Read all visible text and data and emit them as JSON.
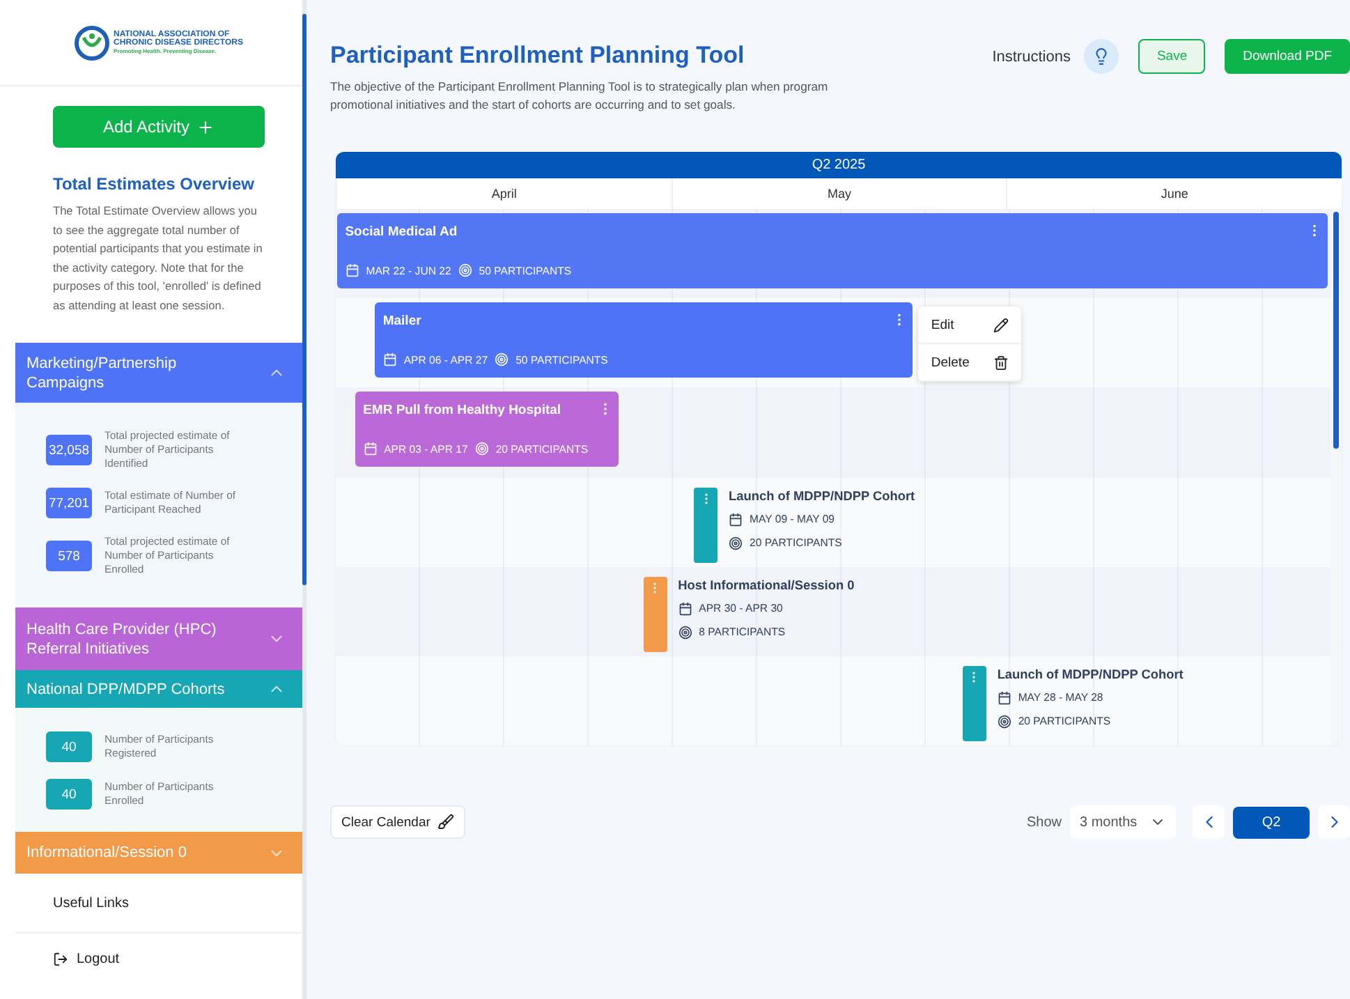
{
  "sidebar": {
    "logo": {
      "lines": [
        "NATIONAL ASSOCIATION OF",
        "CHRONIC DISEASE DIRECTORS",
        "Promoting Health. Preventing Disease."
      ]
    },
    "add_button": "Add Activity",
    "overview": {
      "title": "Total Estimates Overview",
      "text": "The Total Estimate Overview allows you to see the aggregate total number of potential participants that you estimate in the activity category. Note that for the purposes of this tool, 'enrolled' is defined as attending at least one session."
    },
    "categories": [
      {
        "title": "Marketing/Partnership Campaigns",
        "color": "#4f73f5",
        "expanded": true,
        "stats": [
          {
            "value": "32,058",
            "label": "Total projected estimate of Number of Participants Identified"
          },
          {
            "value": "77,201",
            "label": "Total estimate of Number of Participant Reached"
          },
          {
            "value": "578",
            "label": "Total projected estimate of Number of Participants Enrolled"
          }
        ]
      },
      {
        "title": "Health Care Provider (HPC) Referral Initiatives",
        "color": "#b965d8",
        "expanded": false
      },
      {
        "title": "National DPP/MDPP Cohorts",
        "color": "#17a6b4",
        "expanded": true,
        "stats": [
          {
            "value": "40",
            "label": "Number of Participants Registered"
          },
          {
            "value": "40",
            "label": "Number of Participants Enrolled"
          }
        ]
      },
      {
        "title": "Informational/Session 0",
        "color": "#f39a48",
        "expanded": false
      }
    ],
    "links": [
      {
        "label": "Useful Links",
        "kind": "plain"
      },
      {
        "label": "Logout",
        "kind": "logout"
      }
    ]
  },
  "header": {
    "title": "Participant Enrollment Planning Tool",
    "description": "The objective of the Participant Enrollment Planning Tool is to strategically plan when program promotional initiatives and the start of cohorts are occurring and to set goals.",
    "instructions": "Instructions",
    "buttons": [
      {
        "label": "Save",
        "kind": "outline"
      },
      {
        "label": "Download PDF",
        "kind": "solid"
      }
    ]
  },
  "calendar": {
    "quarter": "Q2 2025",
    "months": [
      "April",
      "May",
      "June"
    ],
    "events": [
      {
        "kind": "bar",
        "title": "Social Medical Ad",
        "dates": "MAR 22 - JUN 22",
        "participants": "50 PARTICIPANTS",
        "color": "#5376f4"
      },
      {
        "kind": "bar",
        "title": "Mailer",
        "dates": "APR 06 - APR 27",
        "participants": "50 PARTICIPANTS",
        "color": "#4f73f7",
        "menu": [
          {
            "label": "Edit",
            "kind": "edit"
          },
          {
            "label": "Delete",
            "kind": "delete"
          }
        ]
      },
      {
        "kind": "bar",
        "title": "EMR Pull from Healthy Hospital",
        "dates": "APR 03 - APR 17",
        "participants": "20 PARTICIPANTS",
        "color": "#bb68d8"
      },
      {
        "kind": "marker",
        "title": "Launch of MDPP/NDPP Cohort",
        "dates": "MAY 09 - MAY 09",
        "participants": "20 PARTICIPANTS",
        "color": "#17a6b4"
      },
      {
        "kind": "marker",
        "title": "Host Informational/Session 0",
        "dates": "APR 30 - APR 30",
        "participants": "8 PARTICIPANTS",
        "color": "#f39a48"
      },
      {
        "kind": "marker",
        "title": "Launch of MDPP/NDPP Cohort",
        "dates": "MAY 28 - MAY 28",
        "participants": "20 PARTICIPANTS",
        "color": "#17a6b4"
      }
    ]
  },
  "footer": {
    "clear": "Clear Calendar",
    "show": "Show",
    "range": "3 months",
    "period": "Q2"
  }
}
